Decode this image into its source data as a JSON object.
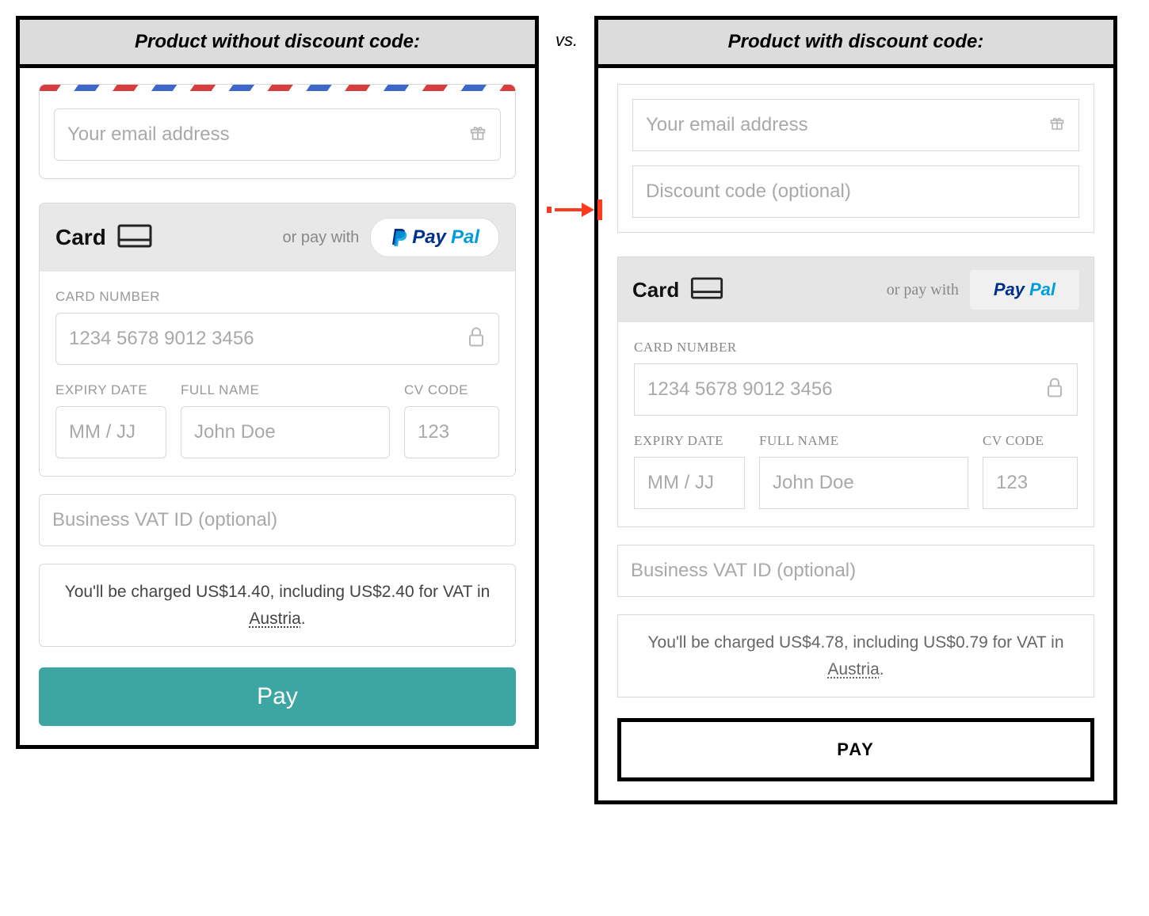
{
  "vs_label": "vs.",
  "left": {
    "header": "Product without discount code:",
    "email_placeholder": "Your email address",
    "card_label": "Card",
    "or_pay_with": "or pay with",
    "paypal_dark": "Pay",
    "paypal_light": "Pal",
    "card_number_label": "CARD NUMBER",
    "card_number_placeholder": "1234 5678 9012 3456",
    "expiry_label": "EXPIRY DATE",
    "expiry_placeholder": "MM / JJ",
    "fullname_label": "FULL NAME",
    "fullname_placeholder": "John Doe",
    "cv_label": "CV CODE",
    "cv_placeholder": "123",
    "vat_placeholder": "Business VAT ID (optional)",
    "charge_prefix": "You'll be charged US$14.40, including US$2.40 for VAT in ",
    "charge_country": "Austria",
    "charge_suffix": ".",
    "pay_button": "Pay"
  },
  "right": {
    "header": "Product with discount code:",
    "email_placeholder": "Your email address",
    "discount_placeholder": "Discount code (optional)",
    "card_label": "Card",
    "or_pay_with": "or pay with",
    "paypal_dark": "Pay",
    "paypal_light": "Pal",
    "card_number_label": "CARD NUMBER",
    "card_number_placeholder": "1234 5678 9012 3456",
    "expiry_label": "EXPIRY DATE",
    "expiry_placeholder": "MM / JJ",
    "fullname_label": "FULL NAME",
    "fullname_placeholder": "John Doe",
    "cv_label": "CV CODE",
    "cv_placeholder": "123",
    "vat_placeholder": "Business VAT ID (optional)",
    "charge_prefix": "You'll be charged US$4.78, including US$0.79 for VAT in ",
    "charge_country": "Austria",
    "charge_suffix": ".",
    "pay_button": "PAY"
  }
}
